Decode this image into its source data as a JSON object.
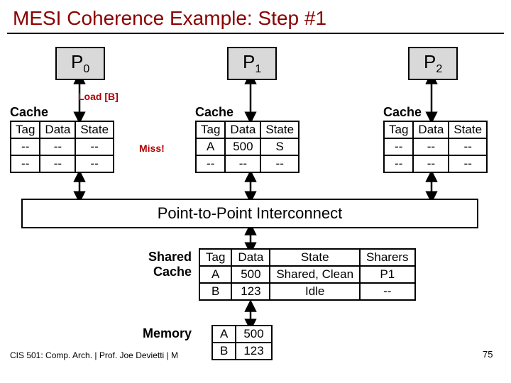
{
  "title": "MESI Coherence Example: Step #1",
  "processors": {
    "p0": "P",
    "p0s": "0",
    "p1": "P",
    "p1s": "1",
    "p2": "P",
    "p2s": "2"
  },
  "load_label": "Load [B]",
  "miss_label": "Miss!",
  "cache_label0": "Cache",
  "cache_label1": "Cache",
  "cache_label2": "Cache",
  "cache0": {
    "h0": "Tag",
    "h1": "Data",
    "h2": "State",
    "r0c0": "--",
    "r0c1": "--",
    "r0c2": "--",
    "r1c0": "--",
    "r1c1": "--",
    "r1c2": "--"
  },
  "cache1": {
    "h0": "Tag",
    "h1": "Data",
    "h2": "State",
    "r0c0": "A",
    "r0c1": "500",
    "r0c2": "S",
    "r1c0": "--",
    "r1c1": "--",
    "r1c2": "--"
  },
  "cache2": {
    "h0": "Tag",
    "h1": "Data",
    "h2": "State",
    "r0c0": "--",
    "r0c1": "--",
    "r0c2": "--",
    "r1c0": "--",
    "r1c1": "--",
    "r1c2": "--"
  },
  "interconnect": "Point-to-Point Interconnect",
  "shared_label_1": "Shared",
  "shared_label_2": "Cache",
  "shared": {
    "h0": "Tag",
    "h1": "Data",
    "h2": "State",
    "h3": "Sharers",
    "r0c0": "A",
    "r0c1": "500",
    "r0c2": "Shared, Clean",
    "r0c3": "P1",
    "r1c0": "B",
    "r1c1": "123",
    "r1c2": "Idle",
    "r1c3": "--"
  },
  "memory_label": "Memory",
  "memory": {
    "r0c0": "A",
    "r0c1": "500",
    "r1c0": "B",
    "r1c1": "123"
  },
  "footer": "CIS 501: Comp. Arch.   |   Prof. Joe Devietti   |   M",
  "pagenum": "75"
}
